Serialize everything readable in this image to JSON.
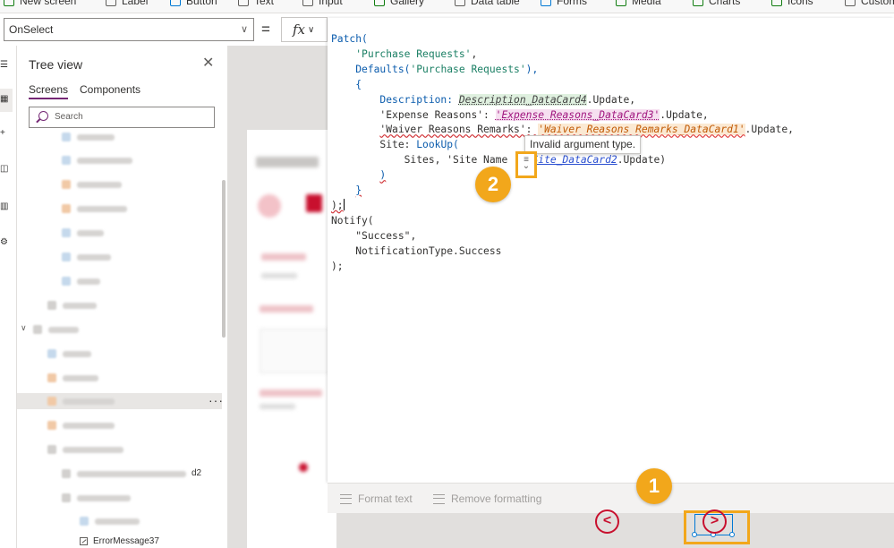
{
  "ribbon": {
    "items": [
      "New screen",
      "Label",
      "Button",
      "Text",
      "Input",
      "Gallery",
      "Data table",
      "Forms",
      "Media",
      "Charts",
      "Icons",
      "Custom"
    ]
  },
  "formula_bar": {
    "property": "OnSelect",
    "equals": "=",
    "fx_label": "fx"
  },
  "tree_view": {
    "title": "Tree view",
    "tabs": [
      "Screens",
      "Components"
    ],
    "search_placeholder": "Search",
    "partial_row_suffix": "d2",
    "last_row_label": "ErrorMessage37"
  },
  "editor": {
    "code": {
      "l1_fn": "Patch(",
      "l2_str": "'Purchase Requests'",
      "l2_tail": ",",
      "l3_fn": "Defaults(",
      "l3_str": "'Purchase Requests'",
      "l3_tail": "),",
      "l4": "{",
      "l5_key": "Description: ",
      "l5_ctl": "Description_DataCard4",
      "l5_tail": ".Update,",
      "l6_key": "'Expense Reasons': ",
      "l6_ctl": "'Expense Reasons_DataCard3'",
      "l6_tail": ".Update,",
      "l7_key": "'Waiver Reasons Remarks': ",
      "l7_ctl": "'Waiver Reasons Remarks_DataCard1'",
      "l7_tail": ".Update,",
      "l8_key": "Site: ",
      "l8_fn": "LookUp(",
      "l9_head": "Sites, 'Site Name",
      "l9_ctl": "Site_DataCard2",
      "l9_tail": ".Update)",
      "l10": ")",
      "l11": "}",
      "l12": ");",
      "l13_fn": "Notify(",
      "l14_str": "\"Success\"",
      "l14_tail": ",",
      "l15": "NotificationType.Success",
      "l16": ");"
    },
    "tooltip": "Invalid argument type.",
    "footer": {
      "format_text": "Format text",
      "remove_formatting": "Remove formatting"
    }
  },
  "badges": {
    "one": "1",
    "two": "2"
  },
  "navigation": {
    "prev": "<",
    "next": ">"
  },
  "colors": {
    "accent_purple": "#742774",
    "callout_orange": "#f2a71b",
    "nav_red": "#c8102e",
    "selection_blue": "#0078d4"
  }
}
